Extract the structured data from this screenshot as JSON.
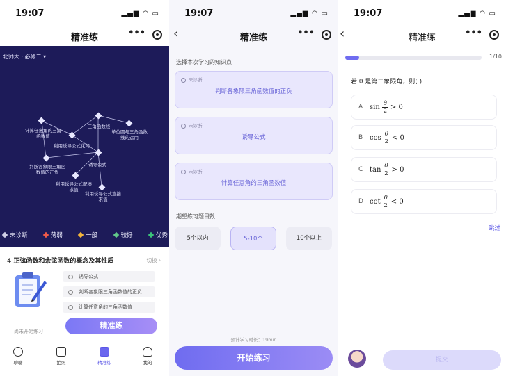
{
  "status": {
    "time": "19:07"
  },
  "screen1": {
    "title": "精准练",
    "more": "•••",
    "book": "北师大 · 必修二 ▾",
    "nodes": [
      {
        "text": "计算任意角的三角\n函数值"
      },
      {
        "text": "三角函数线"
      },
      {
        "text": "单位圆与三角函数\n线的运用"
      },
      {
        "text": "利用诱导公式化简"
      },
      {
        "text": "判断各象限三角函\n数值的正负"
      },
      {
        "text": "诱导公式"
      },
      {
        "text": "利用诱导公式配凑\n求值"
      },
      {
        "text": "利用诱导公式直接\n求值"
      }
    ],
    "legend": [
      {
        "label": "未诊断",
        "color": "#cfcfe6"
      },
      {
        "label": "薄弱",
        "color": "#f05a4a"
      },
      {
        "label": "一般",
        "color": "#f4b53b"
      },
      {
        "label": "较好",
        "color": "#62c98a"
      },
      {
        "label": "优秀",
        "color": "#3bc27a"
      }
    ],
    "card": {
      "title": "4 正弦函数和余弦函数的概念及其性质",
      "switch": "切换 ›",
      "items": [
        "诱导公式",
        "判断各象限三角函数值的正负",
        "计算任意角的三角函数值"
      ],
      "not_started": "尚未开始练习",
      "button": "精准练"
    },
    "tabs": [
      {
        "label": "聊聊",
        "icon": "chat-face-icon"
      },
      {
        "label": "拍照",
        "icon": "camera-icon"
      },
      {
        "label": "精准练",
        "icon": "practice-icon"
      },
      {
        "label": "我的",
        "icon": "person-icon"
      }
    ]
  },
  "screen2": {
    "title": "精准练",
    "more": "•••",
    "section_kp": "选择本次学习的知识点",
    "kp_cards": [
      {
        "status": "未诊断",
        "text": "判断各象限三角函数值的正负"
      },
      {
        "status": "未诊断",
        "text": "诱导公式"
      },
      {
        "status": "未诊断",
        "text": "计算任意角的三角函数值"
      }
    ],
    "section_count": "期望练习题目数",
    "counts": [
      {
        "label": "5个以内",
        "selected": false
      },
      {
        "label": "5-10个",
        "selected": true
      },
      {
        "label": "10个以上",
        "selected": false
      }
    ],
    "estimate": "预计学习时长：19min",
    "start": "开始练习"
  },
  "screen3": {
    "title": "精准练",
    "more": "•••",
    "progress": {
      "current": 1,
      "total": 10,
      "text": "1/10"
    },
    "question": "若 θ 是第二象限角，则( )",
    "options": [
      {
        "letter": "A",
        "fn": "sin",
        "num": "θ",
        "den": "2",
        "rel": "> 0"
      },
      {
        "letter": "B",
        "fn": "cos",
        "num": "θ",
        "den": "2",
        "rel": "< 0"
      },
      {
        "letter": "C",
        "fn": "tan",
        "num": "θ",
        "den": "2",
        "rel": "> 0"
      },
      {
        "letter": "D",
        "fn": "cot",
        "num": "θ",
        "den": "2",
        "rel": "< 0"
      }
    ],
    "skip": "跳过",
    "submit": "提交"
  }
}
